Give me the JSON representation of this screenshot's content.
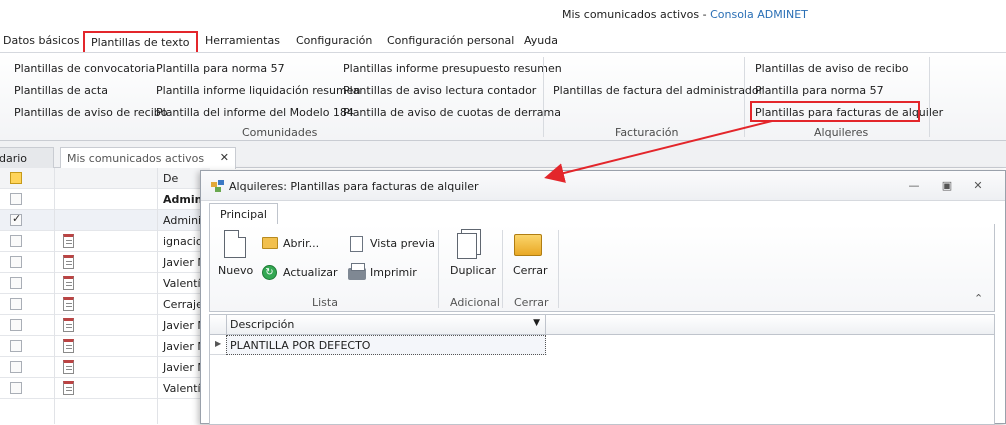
{
  "window": {
    "title": "Mis comunicados activos",
    "title_sep": " - ",
    "app_name": "Consola ADMINET"
  },
  "menu": [
    {
      "label": "Datos básicos"
    },
    {
      "label": "Plantillas de texto",
      "active": true
    },
    {
      "label": "Herramientas"
    },
    {
      "label": "Configuración"
    },
    {
      "label": "Configuración personal"
    },
    {
      "label": "Ayuda"
    }
  ],
  "ribbon": {
    "comunidades": {
      "label": "Comunidades",
      "col1": [
        "Plantillas de convocatoria",
        "Plantillas de acta",
        "Plantillas de aviso de recibo"
      ],
      "col2": [
        "Plantilla para norma 57",
        "Plantilla informe liquidación resumen",
        "Plantilla del informe del Modelo 184"
      ],
      "col3": [
        "Plantillas informe presupuesto resumen",
        "Plantillas de aviso lectura contador",
        "Plantilla de aviso de cuotas de derrama"
      ]
    },
    "facturacion": {
      "label": "Facturación",
      "items": [
        "Plantillas de factura del administrador"
      ]
    },
    "alquileres": {
      "label": "Alquileres",
      "items": [
        "Plantillas de aviso de recibo",
        "Plantilla para norma 57",
        "Plantillas para facturas de alquiler"
      ]
    }
  },
  "doc_tabs": [
    {
      "label": "dario"
    },
    {
      "label": "Mis comunicados activos",
      "close": "✕"
    }
  ],
  "background_grid": {
    "header_col": "De",
    "rows": [
      {
        "checked": false,
        "icon": false,
        "text": "Admin",
        "bold": true
      },
      {
        "checked": true,
        "icon": false,
        "text": "Adminis"
      },
      {
        "checked": false,
        "icon": true,
        "text": "ignacio."
      },
      {
        "checked": false,
        "icon": true,
        "text": "Javier M"
      },
      {
        "checked": false,
        "icon": true,
        "text": "Valentín"
      },
      {
        "checked": false,
        "icon": true,
        "text": "Cerraje"
      },
      {
        "checked": false,
        "icon": true,
        "text": "Javier M"
      },
      {
        "checked": false,
        "icon": true,
        "text": "Javier M"
      },
      {
        "checked": false,
        "icon": true,
        "text": "Javier M"
      },
      {
        "checked": false,
        "icon": true,
        "text": "Valentín"
      }
    ]
  },
  "dialog": {
    "title": "Alquileres: Plantillas para facturas de alquiler",
    "tab": "Principal",
    "buttons": {
      "nuevo": "Nuevo",
      "abrir": "Abrir...",
      "actualizar": "Actualizar",
      "vista_previa": "Vista previa",
      "imprimir": "Imprimir",
      "duplicar": "Duplicar",
      "cerrar": "Cerrar"
    },
    "groups": {
      "lista": "Lista",
      "adicional": "Adicional",
      "cerrar": "Cerrar"
    },
    "grid": {
      "column": "Descripción",
      "rows": [
        "PLANTILLA POR DEFECTO"
      ]
    }
  },
  "colors": {
    "annotation": "#e3262b",
    "link": "#2a6fb5"
  }
}
